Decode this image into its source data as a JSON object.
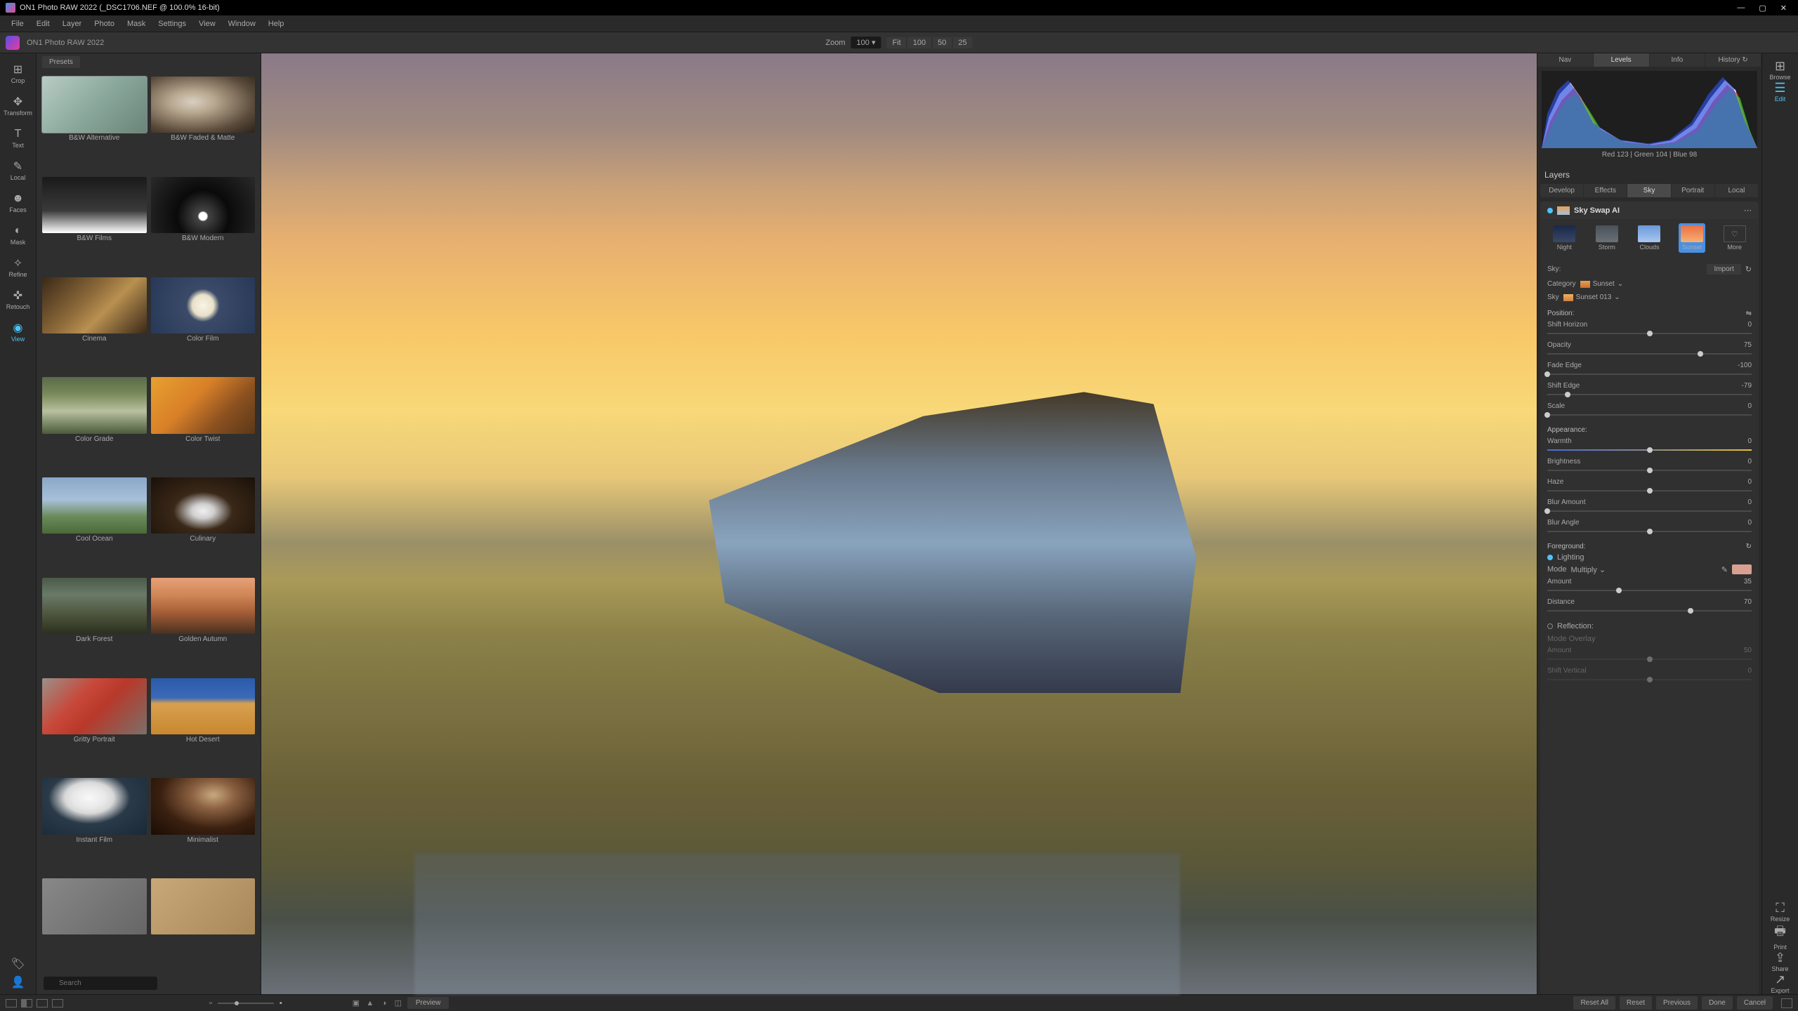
{
  "title": "ON1 Photo RAW 2022 (_DSC1706.NEF @ 100.0% 16-bit)",
  "app_name": "ON1 Photo RAW 2022",
  "menu": [
    "File",
    "Edit",
    "Layer",
    "Photo",
    "Mask",
    "Settings",
    "View",
    "Window",
    "Help"
  ],
  "zoom": {
    "label": "Zoom",
    "value": "100",
    "buttons": [
      "Fit",
      "100",
      "50",
      "25"
    ]
  },
  "left_tools": [
    {
      "icon": "⊞",
      "label": "Crop"
    },
    {
      "icon": "✥",
      "label": "Transform"
    },
    {
      "icon": "T",
      "label": "Text"
    },
    {
      "icon": "✎",
      "label": "Local"
    },
    {
      "icon": "☻",
      "label": "Faces"
    },
    {
      "icon": "◐",
      "label": "Mask"
    },
    {
      "icon": "✧",
      "label": "Refine"
    },
    {
      "icon": "✜",
      "label": "Retouch"
    },
    {
      "icon": "◉",
      "label": "View",
      "active": true
    }
  ],
  "presets": {
    "tab": "Presets",
    "items": [
      {
        "name": "B&W Alternative",
        "thumb": "thumb-bw-alt",
        "selected": true
      },
      {
        "name": "B&W Faded & Matte",
        "thumb": "thumb-bw-faded"
      },
      {
        "name": "B&W Films",
        "thumb": "thumb-bw-films"
      },
      {
        "name": "B&W Modern",
        "thumb": "thumb-bw-modern"
      },
      {
        "name": "Cinema",
        "thumb": "thumb-cinema"
      },
      {
        "name": "Color Film",
        "thumb": "thumb-color-film"
      },
      {
        "name": "Color Grade",
        "thumb": "thumb-color-grade"
      },
      {
        "name": "Color Twist",
        "thumb": "thumb-color-twist"
      },
      {
        "name": "Cool Ocean",
        "thumb": "thumb-cool-ocean"
      },
      {
        "name": "Culinary",
        "thumb": "thumb-culinary"
      },
      {
        "name": "Dark Forest",
        "thumb": "thumb-dark-forest"
      },
      {
        "name": "Golden Autumn",
        "thumb": "thumb-golden-autumn"
      },
      {
        "name": "Gritty Portrait",
        "thumb": "thumb-gritty"
      },
      {
        "name": "Hot Desert",
        "thumb": "thumb-hot-desert"
      },
      {
        "name": "Instant Film",
        "thumb": "thumb-instant"
      },
      {
        "name": "Minimalist",
        "thumb": "thumb-minimalist"
      },
      {
        "name": "",
        "thumb": "thumb-more1"
      },
      {
        "name": "",
        "thumb": "thumb-more2"
      }
    ],
    "search_placeholder": "Search"
  },
  "right": {
    "tabs": [
      "Nav",
      "Levels",
      "Info",
      "History ↻"
    ],
    "active_tab": 1,
    "readout": "Red 123  |  Green 104  |  Blue  98",
    "layers_label": "Layers",
    "modules": [
      "Develop",
      "Effects",
      "Sky",
      "Portrait",
      "Local"
    ],
    "active_module": 2,
    "sky_swap": {
      "title": "Sky Swap AI",
      "presets": [
        {
          "label": "Night",
          "cls": "sp-night"
        },
        {
          "label": "Storm",
          "cls": "sp-storm"
        },
        {
          "label": "Clouds",
          "cls": "sp-clouds"
        },
        {
          "label": "Sunset",
          "cls": "sp-sunset",
          "active": true
        },
        {
          "label": "More",
          "cls": "sp-more",
          "icon": "♡"
        }
      ],
      "sky_label": "Sky:",
      "import_btn": "Import",
      "category": {
        "label": "Category",
        "value": "Sunset"
      },
      "sky_select": {
        "label": "Sky",
        "value": "Sunset 013"
      },
      "sections": {
        "position": {
          "label": "Position:",
          "sliders": [
            {
              "name": "Shift Horizon",
              "value": 0,
              "pos": 50
            },
            {
              "name": "Opacity",
              "value": 75,
              "pos": 75
            },
            {
              "name": "Fade Edge",
              "value": -100,
              "pos": 0
            },
            {
              "name": "Shift Edge",
              "value": -79,
              "pos": 10
            },
            {
              "name": "Scale",
              "value": 0,
              "pos": 0
            }
          ]
        },
        "appearance": {
          "label": "Appearance:",
          "sliders": [
            {
              "name": "Warmth",
              "value": 0,
              "pos": 50,
              "grad": true
            },
            {
              "name": "Brightness",
              "value": 0,
              "pos": 50
            },
            {
              "name": "Haze",
              "value": 0,
              "pos": 50
            },
            {
              "name": "Blur Amount",
              "value": 0,
              "pos": 0
            },
            {
              "name": "Blur Angle",
              "value": 0,
              "pos": 50
            }
          ]
        },
        "foreground": {
          "label": "Foreground:",
          "lighting": "Lighting",
          "mode_label": "Mode",
          "mode_value": "Multiply",
          "sliders": [
            {
              "name": "Amount",
              "value": 35,
              "pos": 35
            },
            {
              "name": "Distance",
              "value": 70,
              "pos": 70
            }
          ]
        },
        "reflection": {
          "label": "Reflection:",
          "mode_label": "Mode",
          "mode_value": "Overlay",
          "sliders": [
            {
              "name": "Amount",
              "value": 50,
              "pos": 50
            },
            {
              "name": "Shift Vertical",
              "value": 0,
              "pos": 50
            }
          ]
        }
      }
    }
  },
  "right_toolbar": [
    {
      "icon": "⊞",
      "label": "Browse"
    },
    {
      "icon": "☰",
      "label": "Edit",
      "active": true
    }
  ],
  "right_toolbar_bottom": [
    {
      "icon": "⛶",
      "label": "Resize"
    },
    {
      "icon": "🖶",
      "label": "Print"
    },
    {
      "icon": "⇪",
      "label": "Share"
    },
    {
      "icon": "↗",
      "label": "Export"
    }
  ],
  "statusbar": {
    "preview": "Preview",
    "buttons": [
      "Reset All",
      "Reset",
      "Previous",
      "Done",
      "Cancel"
    ]
  }
}
